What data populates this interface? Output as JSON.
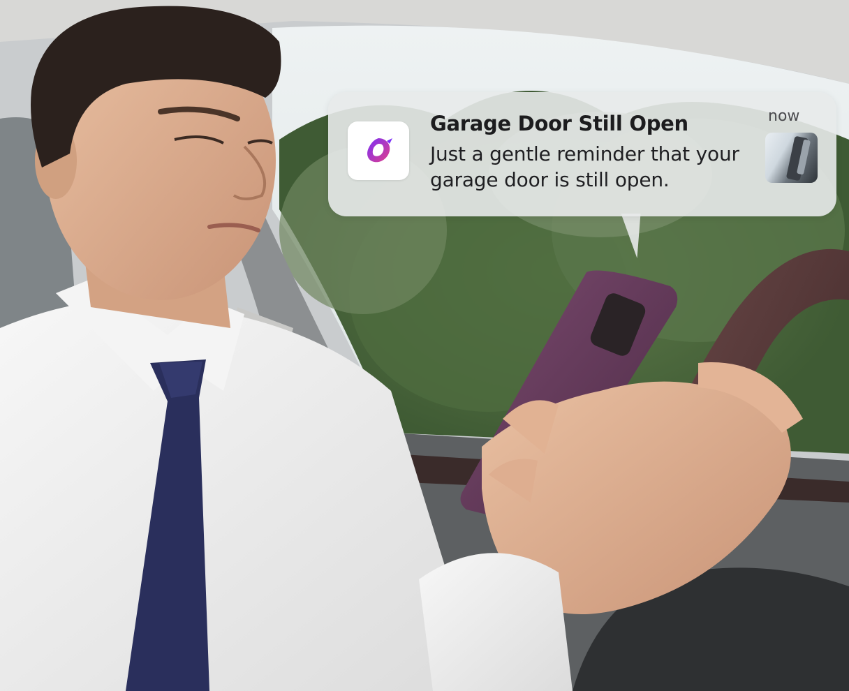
{
  "notification": {
    "title": "Garage Door Still Open",
    "body": "Just a gentle reminder that your garage door is still open.",
    "time": "now",
    "app_icon": "bird-logo-icon",
    "thumbnail": "garage-door-thumbnail"
  },
  "colors": {
    "bubble": "#e8eaea",
    "app_icon_gradient_start": "#7b2ff7",
    "app_icon_gradient_end": "#e0408a"
  }
}
